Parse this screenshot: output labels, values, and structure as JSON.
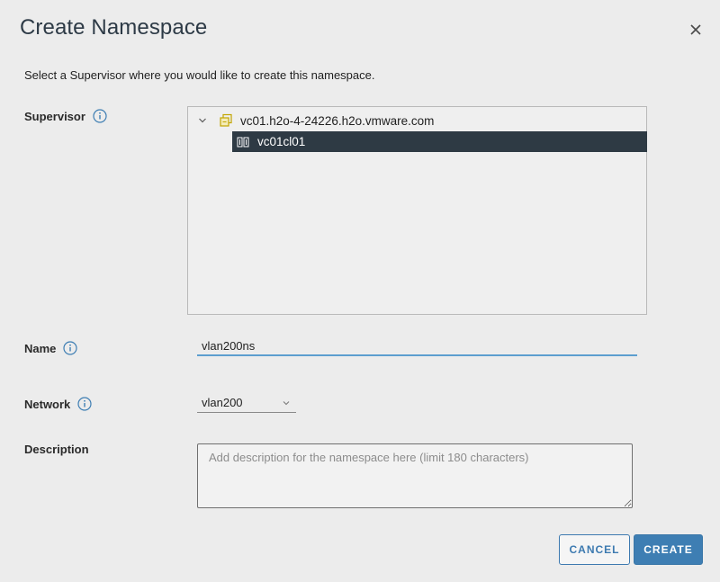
{
  "dialog": {
    "title": "Create Namespace",
    "subtitle": "Select a Supervisor where you would like to create this namespace."
  },
  "fields": {
    "supervisor_label": "Supervisor",
    "name_label": "Name",
    "network_label": "Network",
    "description_label": "Description"
  },
  "tree": {
    "root": {
      "label": "vc01.h2o-4-24226.h2o.vmware.com",
      "expanded": true,
      "icon": "datacenter-icon"
    },
    "child": {
      "label": "vc01cl01",
      "selected": true,
      "icon": "cluster-icon"
    }
  },
  "name_input": {
    "value": "vlan200ns"
  },
  "network_select": {
    "value": "vlan200"
  },
  "description_input": {
    "placeholder": "Add description for the namespace here (limit 180 characters)",
    "value": ""
  },
  "buttons": {
    "cancel": "CANCEL",
    "create": "CREATE"
  },
  "colors": {
    "accent": "#3e7eb3",
    "selected_row": "#2e3a44",
    "input_focus": "#5c9ecf"
  }
}
